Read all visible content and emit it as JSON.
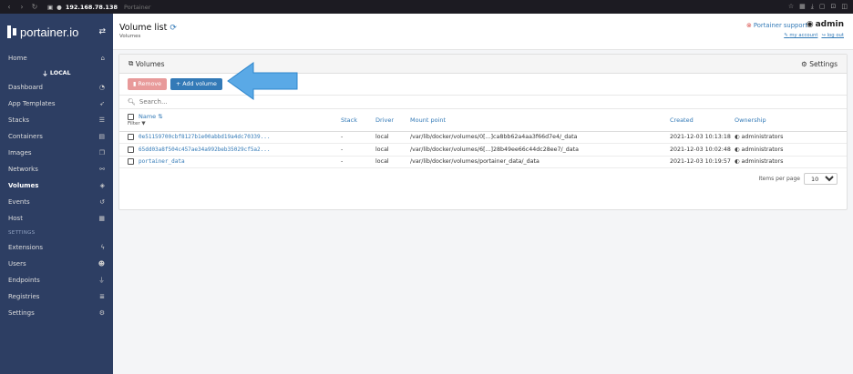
{
  "browser": {
    "url": "192.168.78.138",
    "page_title": "Portainer"
  },
  "sidebar": {
    "brand": "portainer.io",
    "endpoint_label": "LOCAL",
    "items": [
      {
        "label": "Home",
        "icon": "home-icon"
      },
      {
        "label": "Dashboard",
        "icon": "dashboard-icon"
      },
      {
        "label": "App Templates",
        "icon": "rocket-icon"
      },
      {
        "label": "Stacks",
        "icon": "list-icon"
      },
      {
        "label": "Containers",
        "icon": "server-icon"
      },
      {
        "label": "Images",
        "icon": "clone-icon"
      },
      {
        "label": "Networks",
        "icon": "sitemap-icon"
      },
      {
        "label": "Volumes",
        "icon": "cubes-icon"
      },
      {
        "label": "Events",
        "icon": "history-icon"
      },
      {
        "label": "Host",
        "icon": "th-icon"
      }
    ],
    "settings_section": "SETTINGS",
    "settings_items": [
      {
        "label": "Extensions",
        "icon": "bolt-icon"
      },
      {
        "label": "Users",
        "icon": "users-icon"
      },
      {
        "label": "Endpoints",
        "icon": "plug-icon"
      },
      {
        "label": "Registries",
        "icon": "database-icon"
      },
      {
        "label": "Settings",
        "icon": "cogs-icon"
      }
    ]
  },
  "header": {
    "title": "Volume list",
    "breadcrumb": "Volumes",
    "support": "Portainer support",
    "user": "admin",
    "my_account": "my account",
    "log_out": "log out"
  },
  "widget": {
    "title": "Volumes",
    "settings": "Settings",
    "remove_label": "Remove",
    "add_label": "+ Add volume",
    "search_placeholder": "Search...",
    "columns": {
      "name": "Name",
      "filter": "Filter",
      "stack": "Stack",
      "driver": "Driver",
      "mount": "Mount point",
      "created": "Created",
      "ownership": "Ownership"
    },
    "rows": [
      {
        "name": "0e51159700cbf8127b1e00abbd19a4dc70339...",
        "stack": "-",
        "driver": "local",
        "mount": "/var/lib/docker/volumes/0[...]ca8bb62a4aa3f66d7e4/_data",
        "created": "2021-12-03 10:13:18",
        "ownership": "administrators"
      },
      {
        "name": "65dd03a8f504c457ae34a992beb35029cf5a2...",
        "stack": "-",
        "driver": "local",
        "mount": "/var/lib/docker/volumes/6[...]28b49ee66c44dc28ee7/_data",
        "created": "2021-12-03 10:02:48",
        "ownership": "administrators"
      },
      {
        "name": "portainer_data",
        "stack": "-",
        "driver": "local",
        "mount": "/var/lib/docker/volumes/portainer_data/_data",
        "created": "2021-12-03 10:19:57",
        "ownership": "administrators"
      }
    ],
    "items_per_page_label": "Items per page",
    "items_per_page_value": "10"
  },
  "colors": {
    "sidebar": "#2d3e63",
    "primary": "#337ab7",
    "danger": "#e89a9a",
    "arrow": "#5aa9e6"
  }
}
